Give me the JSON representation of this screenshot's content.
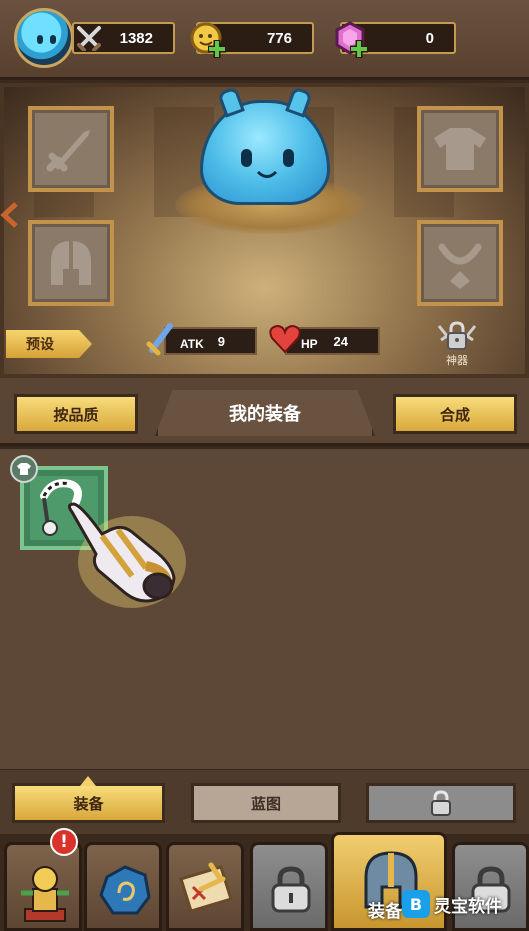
{
  "currency": {
    "power": "1382",
    "gold": "776",
    "gems": "0"
  },
  "hero": {
    "preset_label": "预设",
    "atk_label": "ATK",
    "atk_value": "9",
    "hp_label": "HP",
    "hp_value": "24",
    "artifact_label": "神器"
  },
  "equipment_panel": {
    "title": "我的装备",
    "sort_button": "按品质",
    "merge_button": "合成"
  },
  "tabs": {
    "equipment": "装备",
    "blueprint": "蓝图"
  },
  "nav": {
    "active_label": "装备",
    "alert_badge": "!"
  },
  "watermark": {
    "text": "灵宝软件"
  },
  "colors": {
    "gold_button": "#e9c05a",
    "frame": "#c49a4e",
    "panel": "#5d4736",
    "item_rarity_green": "#3f8458",
    "alert_red": "#d9332b"
  }
}
